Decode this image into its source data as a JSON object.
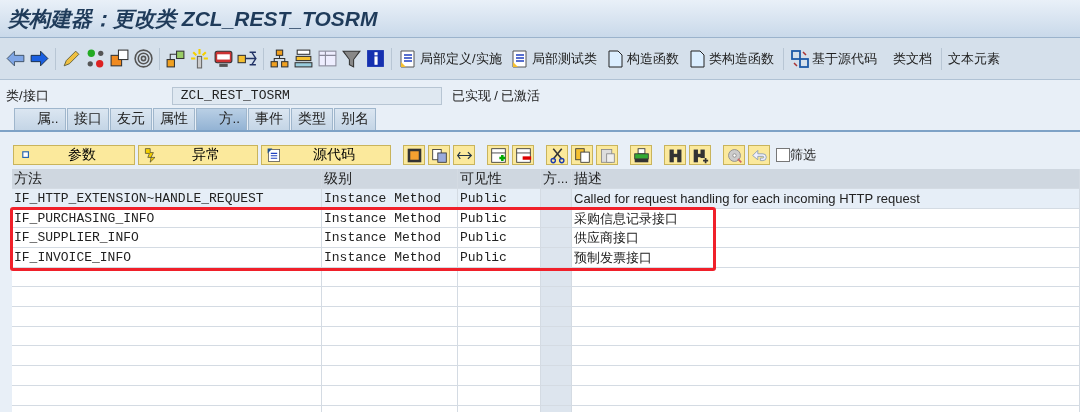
{
  "window": {
    "title": "类构建器：更改类 ZCL_REST_TOSRM"
  },
  "toolbar": {
    "buttons": [
      {
        "label": "局部定义/实施"
      },
      {
        "label": "局部测试类"
      },
      {
        "label": "构造函数"
      },
      {
        "label": "类构造函数"
      },
      {
        "label": "基于源代码"
      },
      {
        "label": "类文档"
      },
      {
        "label": "文本元素"
      }
    ]
  },
  "class_field": {
    "label": "类/接口",
    "value": "ZCL_REST_TOSRM",
    "status": "已实现 / 已激活"
  },
  "tabs": [
    {
      "label": "属..",
      "selected": false
    },
    {
      "label": "接口",
      "selected": false
    },
    {
      "label": "友元",
      "selected": false
    },
    {
      "label": "属性",
      "selected": false
    },
    {
      "label": "方..",
      "selected": true
    },
    {
      "label": "事件",
      "selected": false
    },
    {
      "label": "类型",
      "selected": false
    },
    {
      "label": "别名",
      "selected": false
    }
  ],
  "method_buttons": [
    {
      "label": "参数"
    },
    {
      "label": "异常"
    },
    {
      "label": "源代码"
    }
  ],
  "filter": {
    "label": "筛选",
    "checked": false
  },
  "table": {
    "columns": [
      "方法",
      "级别",
      "可见性",
      "方...",
      "描述"
    ],
    "rows": [
      {
        "method": "IF_HTTP_EXTENSION~HANDLE_REQUEST",
        "level": "Instance Method",
        "visibility": "Public",
        "description": "Called for request handling for each incoming HTTP request",
        "selected": true
      },
      {
        "method": "IF_PURCHASING_INFO",
        "level": "Instance Method",
        "visibility": "Public",
        "description": "采购信息记录接口",
        "selected": false
      },
      {
        "method": "IF_SUPPLIER_INFO",
        "level": "Instance Method",
        "visibility": "Public",
        "description": "供应商接口",
        "selected": false
      },
      {
        "method": "IF_INVOICE_INFO",
        "level": "Instance Method",
        "visibility": "Public",
        "description": "预制发票接口",
        "selected": false
      }
    ]
  }
}
